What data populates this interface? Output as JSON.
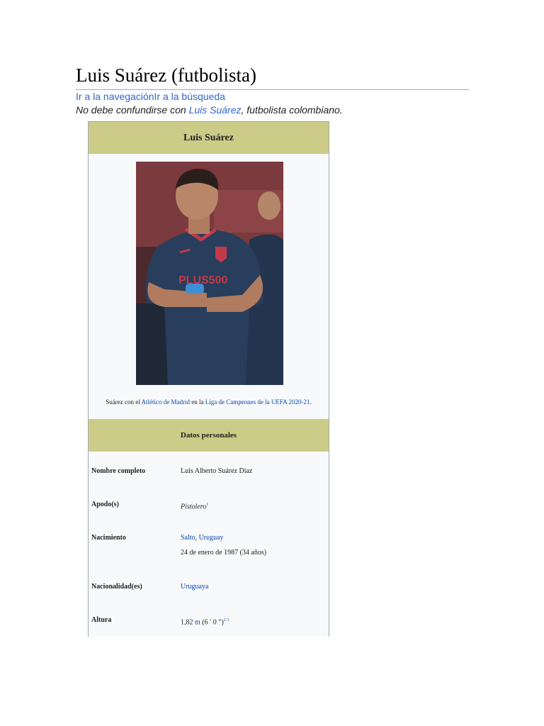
{
  "page": {
    "title": "Luis Suárez (futbolista)",
    "jump_nav": "Ir a la navegación",
    "jump_search": "Ir a la búsqueda",
    "hatnote": {
      "before": "No debe confundirse con ",
      "link": "Luis Suárez",
      "after": ", futbolista colombiano."
    }
  },
  "infobox": {
    "title": "Luis Suárez",
    "caption": {
      "part1": "Suárez con el ",
      "link1": "Atlético de Madrid",
      "part2": " en la ",
      "link2": "Liga de Campeones de la UEFA 2020-21",
      "part3": "."
    },
    "section_header": "Datos personales",
    "rows": {
      "nombre": {
        "label": "Nombre completo",
        "value": "Luis Alberto Suárez Díaz"
      },
      "apodo": {
        "label": "Apodo(s)",
        "value": "Pistolero",
        "ref": "1"
      },
      "nacimiento": {
        "label": "Nacimiento",
        "place_city": "Salto",
        "place_sep": ", ",
        "place_country": "Uruguay",
        "date": "24 de enero de 1987 (34 años)"
      },
      "nacionalidad": {
        "label": "Nacionalidad(es)",
        "value": "Uruguaya"
      },
      "altura": {
        "label": "Altura",
        "value_num": "1,82 ",
        "value_unit": "m",
        "value_rest": " (6 ′ 0 ″)",
        "ref": "2 3"
      }
    }
  }
}
